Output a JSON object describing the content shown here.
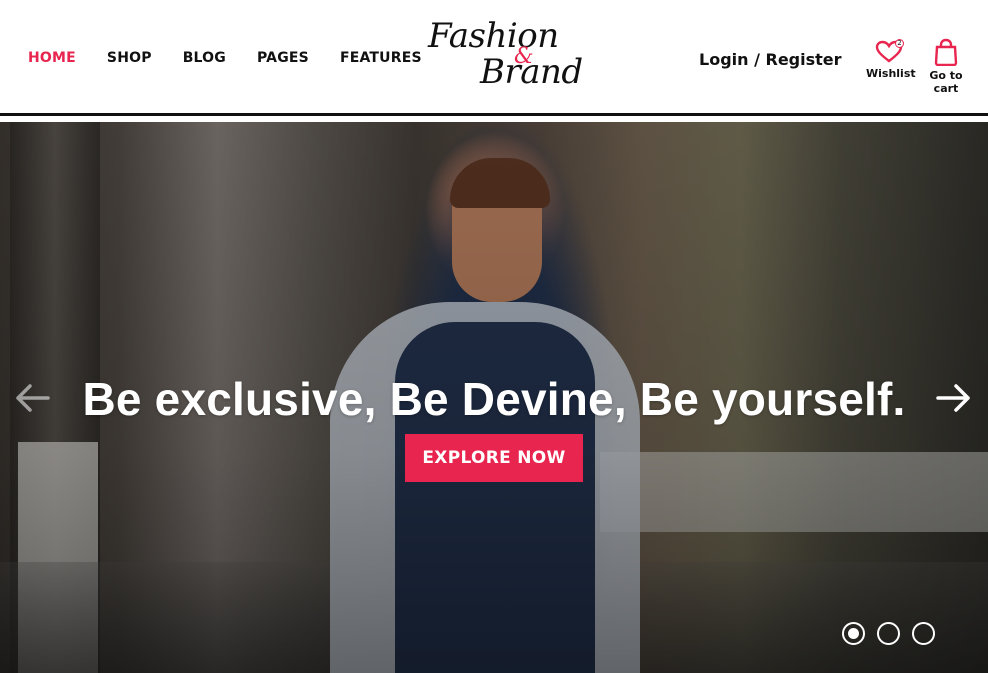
{
  "nav": {
    "items": [
      {
        "label": "HOME",
        "active": true
      },
      {
        "label": "SHOP",
        "active": false
      },
      {
        "label": "BLOG",
        "active": false
      },
      {
        "label": "PAGES",
        "active": false
      },
      {
        "label": "FEATURES",
        "active": false
      }
    ]
  },
  "logo": {
    "line1": "Fashion",
    "amp": "&",
    "line2": "Brand"
  },
  "account": {
    "login_label": "Login / Register"
  },
  "wishlist": {
    "label": "Wishlist",
    "count": "2",
    "icon": "heart-icon"
  },
  "cart": {
    "label": "Go to cart",
    "icon": "shopping-bag-icon"
  },
  "hero": {
    "headline": "Be exclusive, Be Devine, Be yourself.",
    "cta_label": "EXPLORE NOW",
    "prev_icon": "arrow-left-icon",
    "next_icon": "arrow-right-icon",
    "slides": 3,
    "active_slide": 1
  },
  "colors": {
    "accent": "#e8254f",
    "text": "#111111",
    "hero_text": "#ffffff"
  }
}
